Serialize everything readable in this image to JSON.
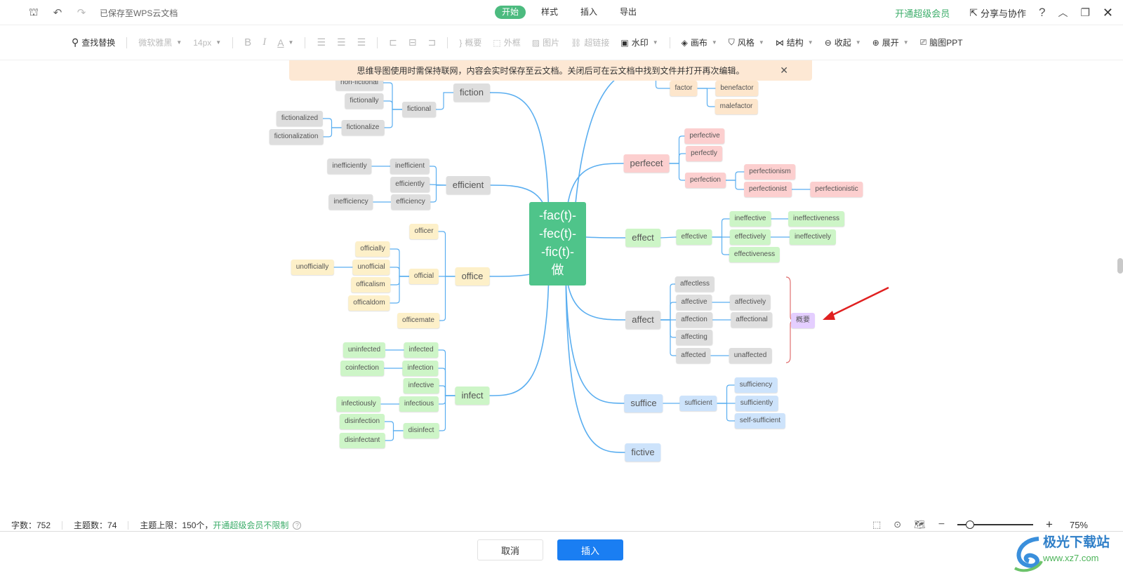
{
  "topbar": {
    "save_status": "已保存至WPS云文档",
    "tabs": [
      "开始",
      "样式",
      "插入",
      "导出"
    ],
    "active_tab": "开始",
    "vip_link": "开通超级会员",
    "share": "分享与协作",
    "icons": [
      "format-painter-icon",
      "undo-icon",
      "redo-icon",
      "help-icon",
      "collapse-icon",
      "restore-window-icon",
      "close-icon"
    ]
  },
  "toolbar": {
    "find_replace": "查找替换",
    "font": "微软雅黑",
    "font_size": "14px",
    "bold": "B",
    "italic": "I",
    "font_color": "A",
    "summary": "概要",
    "border": "外框",
    "image": "图片",
    "hyperlink": "超链接",
    "watermark": "水印",
    "canvas": "画布",
    "style": "风格",
    "structure": "结构",
    "collapse": "收起",
    "expand": "展开",
    "mindmap_ppt": "脑图PPT"
  },
  "notice": {
    "text": "思维导图使用时需保持联网，内容会实时保存至云文档。关闭后可在云文档中找到文件并打开再次编辑。"
  },
  "mindmap": {
    "root_lines": [
      "-fac(t)-",
      "-fec(t)-",
      "-fic(t)-",
      "做"
    ],
    "nodes": [
      {
        "id": "fiction",
        "label": "fiction",
        "color": "gray",
        "level": 1,
        "side": "left",
        "parent": "root"
      },
      {
        "id": "fictional",
        "label": "fictional",
        "color": "gray",
        "parent": "fiction"
      },
      {
        "id": "non-fictional",
        "label": "non-fictional",
        "color": "gray",
        "parent": "fictional"
      },
      {
        "id": "fictionally",
        "label": "fictionally",
        "color": "gray",
        "parent": "fictional"
      },
      {
        "id": "fictionalize",
        "label": "fictionalize",
        "color": "gray",
        "parent": "fictional"
      },
      {
        "id": "fictionalized",
        "label": "fictionalized",
        "color": "gray",
        "parent": "fictionalize"
      },
      {
        "id": "fictionalization",
        "label": "fictionalization",
        "color": "gray",
        "parent": "fictionalize"
      },
      {
        "id": "efficient",
        "label": "efficient",
        "color": "gray",
        "level": 1,
        "side": "left",
        "parent": "root"
      },
      {
        "id": "inefficient",
        "label": "inefficient",
        "color": "gray",
        "parent": "efficient"
      },
      {
        "id": "efficiently",
        "label": "efficiently",
        "color": "gray",
        "parent": "efficient"
      },
      {
        "id": "efficiency",
        "label": "efficiency",
        "color": "gray",
        "parent": "efficient"
      },
      {
        "id": "inefficiently",
        "label": "inefficiently",
        "color": "gray",
        "parent": "inefficient"
      },
      {
        "id": "inefficiency",
        "label": "inefficiency",
        "color": "gray",
        "parent": "efficiency"
      },
      {
        "id": "office",
        "label": "office",
        "color": "yellow",
        "level": 1,
        "side": "left",
        "parent": "root"
      },
      {
        "id": "officer",
        "label": "officer",
        "color": "yellow",
        "parent": "office"
      },
      {
        "id": "official",
        "label": "official",
        "color": "yellow",
        "parent": "office"
      },
      {
        "id": "officemate",
        "label": "officemate",
        "color": "yellow",
        "parent": "office"
      },
      {
        "id": "officially",
        "label": "officially",
        "color": "yellow",
        "parent": "official"
      },
      {
        "id": "unofficial",
        "label": "unofficial",
        "color": "yellow",
        "parent": "official"
      },
      {
        "id": "officalism",
        "label": "officalism",
        "color": "yellow",
        "parent": "official"
      },
      {
        "id": "officaldom",
        "label": "officaldom",
        "color": "yellow",
        "parent": "official"
      },
      {
        "id": "unofficially",
        "label": "unofficially",
        "color": "yellow",
        "parent": "unofficial"
      },
      {
        "id": "infect",
        "label": "infect",
        "color": "green",
        "level": 1,
        "side": "left",
        "parent": "root"
      },
      {
        "id": "infected",
        "label": "infected",
        "color": "green",
        "parent": "infect"
      },
      {
        "id": "infection",
        "label": "infection",
        "color": "green",
        "parent": "infect"
      },
      {
        "id": "infective",
        "label": "infective",
        "color": "green",
        "parent": "infect"
      },
      {
        "id": "infectious",
        "label": "infectious",
        "color": "green",
        "parent": "infect"
      },
      {
        "id": "disinfect",
        "label": "disinfect",
        "color": "green",
        "parent": "infect"
      },
      {
        "id": "uninfected",
        "label": "uninfected",
        "color": "green",
        "parent": "infected"
      },
      {
        "id": "coinfection",
        "label": "coinfection",
        "color": "green",
        "parent": "infection"
      },
      {
        "id": "infectiously",
        "label": "infectiously",
        "color": "green",
        "parent": "infectious"
      },
      {
        "id": "disinfection",
        "label": "disinfection",
        "color": "green",
        "parent": "disinfect"
      },
      {
        "id": "disinfectant",
        "label": "disinfectant",
        "color": "green",
        "parent": "disinfect"
      },
      {
        "id": "factor",
        "label": "factor",
        "color": "peach",
        "parent": "root-top"
      },
      {
        "id": "benefactor",
        "label": "benefactor",
        "color": "peach",
        "parent": "factor"
      },
      {
        "id": "malefactor",
        "label": "malefactor",
        "color": "peach",
        "parent": "factor"
      },
      {
        "id": "perfecet",
        "label": "perfecet",
        "color": "pink",
        "level": 1,
        "side": "right",
        "parent": "root"
      },
      {
        "id": "perfective",
        "label": "perfective",
        "color": "pink",
        "parent": "perfecet"
      },
      {
        "id": "perfectly",
        "label": "perfectly",
        "color": "pink",
        "parent": "perfecet"
      },
      {
        "id": "perfection",
        "label": "perfection",
        "color": "pink",
        "parent": "perfecet"
      },
      {
        "id": "perfectionism",
        "label": "perfectionism",
        "color": "pink",
        "parent": "perfection"
      },
      {
        "id": "perfectionist",
        "label": "perfectionist",
        "color": "pink",
        "parent": "perfection"
      },
      {
        "id": "perfectionistic",
        "label": "perfectionistic",
        "color": "pink",
        "parent": "perfectionist"
      },
      {
        "id": "effect",
        "label": "effect",
        "color": "green",
        "level": 1,
        "side": "right",
        "parent": "root"
      },
      {
        "id": "effective",
        "label": "effective",
        "color": "green",
        "parent": "effect"
      },
      {
        "id": "ineffective",
        "label": "ineffective",
        "color": "green",
        "parent": "effective"
      },
      {
        "id": "effectively",
        "label": "effectively",
        "color": "green",
        "parent": "effective"
      },
      {
        "id": "effectiveness",
        "label": "effectiveness",
        "color": "green",
        "parent": "effective"
      },
      {
        "id": "ineffectiveness",
        "label": "ineffectiveness",
        "color": "green",
        "parent": "ineffective"
      },
      {
        "id": "ineffectively",
        "label": "ineffectively",
        "color": "green",
        "parent": "effectively"
      },
      {
        "id": "affect",
        "label": "affect",
        "color": "gray",
        "level": 1,
        "side": "right",
        "parent": "root"
      },
      {
        "id": "affectless",
        "label": "affectless",
        "color": "gray",
        "parent": "affect"
      },
      {
        "id": "affective",
        "label": "affective",
        "color": "gray",
        "parent": "affect"
      },
      {
        "id": "affection",
        "label": "affection",
        "color": "gray",
        "parent": "affect"
      },
      {
        "id": "affecting",
        "label": "affecting",
        "color": "gray",
        "parent": "affect"
      },
      {
        "id": "affected",
        "label": "affected",
        "color": "gray",
        "parent": "affect"
      },
      {
        "id": "affectively",
        "label": "affectively",
        "color": "gray",
        "parent": "affective"
      },
      {
        "id": "affectional",
        "label": "affectional",
        "color": "gray",
        "parent": "affection"
      },
      {
        "id": "unaffected",
        "label": "unaffected",
        "color": "gray",
        "parent": "affected"
      },
      {
        "id": "summary",
        "label": "概要",
        "color": "purple",
        "parent": "affect-summary"
      },
      {
        "id": "suffice",
        "label": "suffice",
        "color": "blue",
        "level": 1,
        "side": "right",
        "parent": "root"
      },
      {
        "id": "sufficient",
        "label": "sufficient",
        "color": "blue",
        "parent": "suffice"
      },
      {
        "id": "sufficiency",
        "label": "sufficiency",
        "color": "blue",
        "parent": "sufficient"
      },
      {
        "id": "sufficiently",
        "label": "sufficiently",
        "color": "blue",
        "parent": "sufficient"
      },
      {
        "id": "self-sufficient",
        "label": "self-sufficient",
        "color": "blue",
        "parent": "sufficient"
      },
      {
        "id": "fictive",
        "label": "fictive",
        "color": "blue",
        "level": 1,
        "side": "right",
        "parent": "root"
      }
    ]
  },
  "status": {
    "word_count": "字数：752",
    "topic_count": "主题数：74",
    "topic_limit": "主题上限：150个，",
    "vip_unlimited": "开通超级会员不限制",
    "zoom": "75%",
    "zoom_fraction": 0.17
  },
  "footer": {
    "cancel": "取消",
    "insert": "插入"
  },
  "watermark": {
    "brand": "极光下载站",
    "url": "www.xz7.com"
  },
  "colors": {
    "accent_green": "#4cbb7f",
    "primary_blue": "#1a7ef2",
    "link_line": "#5aaef0",
    "summary_bracket": "#e07070",
    "arrow": "#e02020"
  }
}
